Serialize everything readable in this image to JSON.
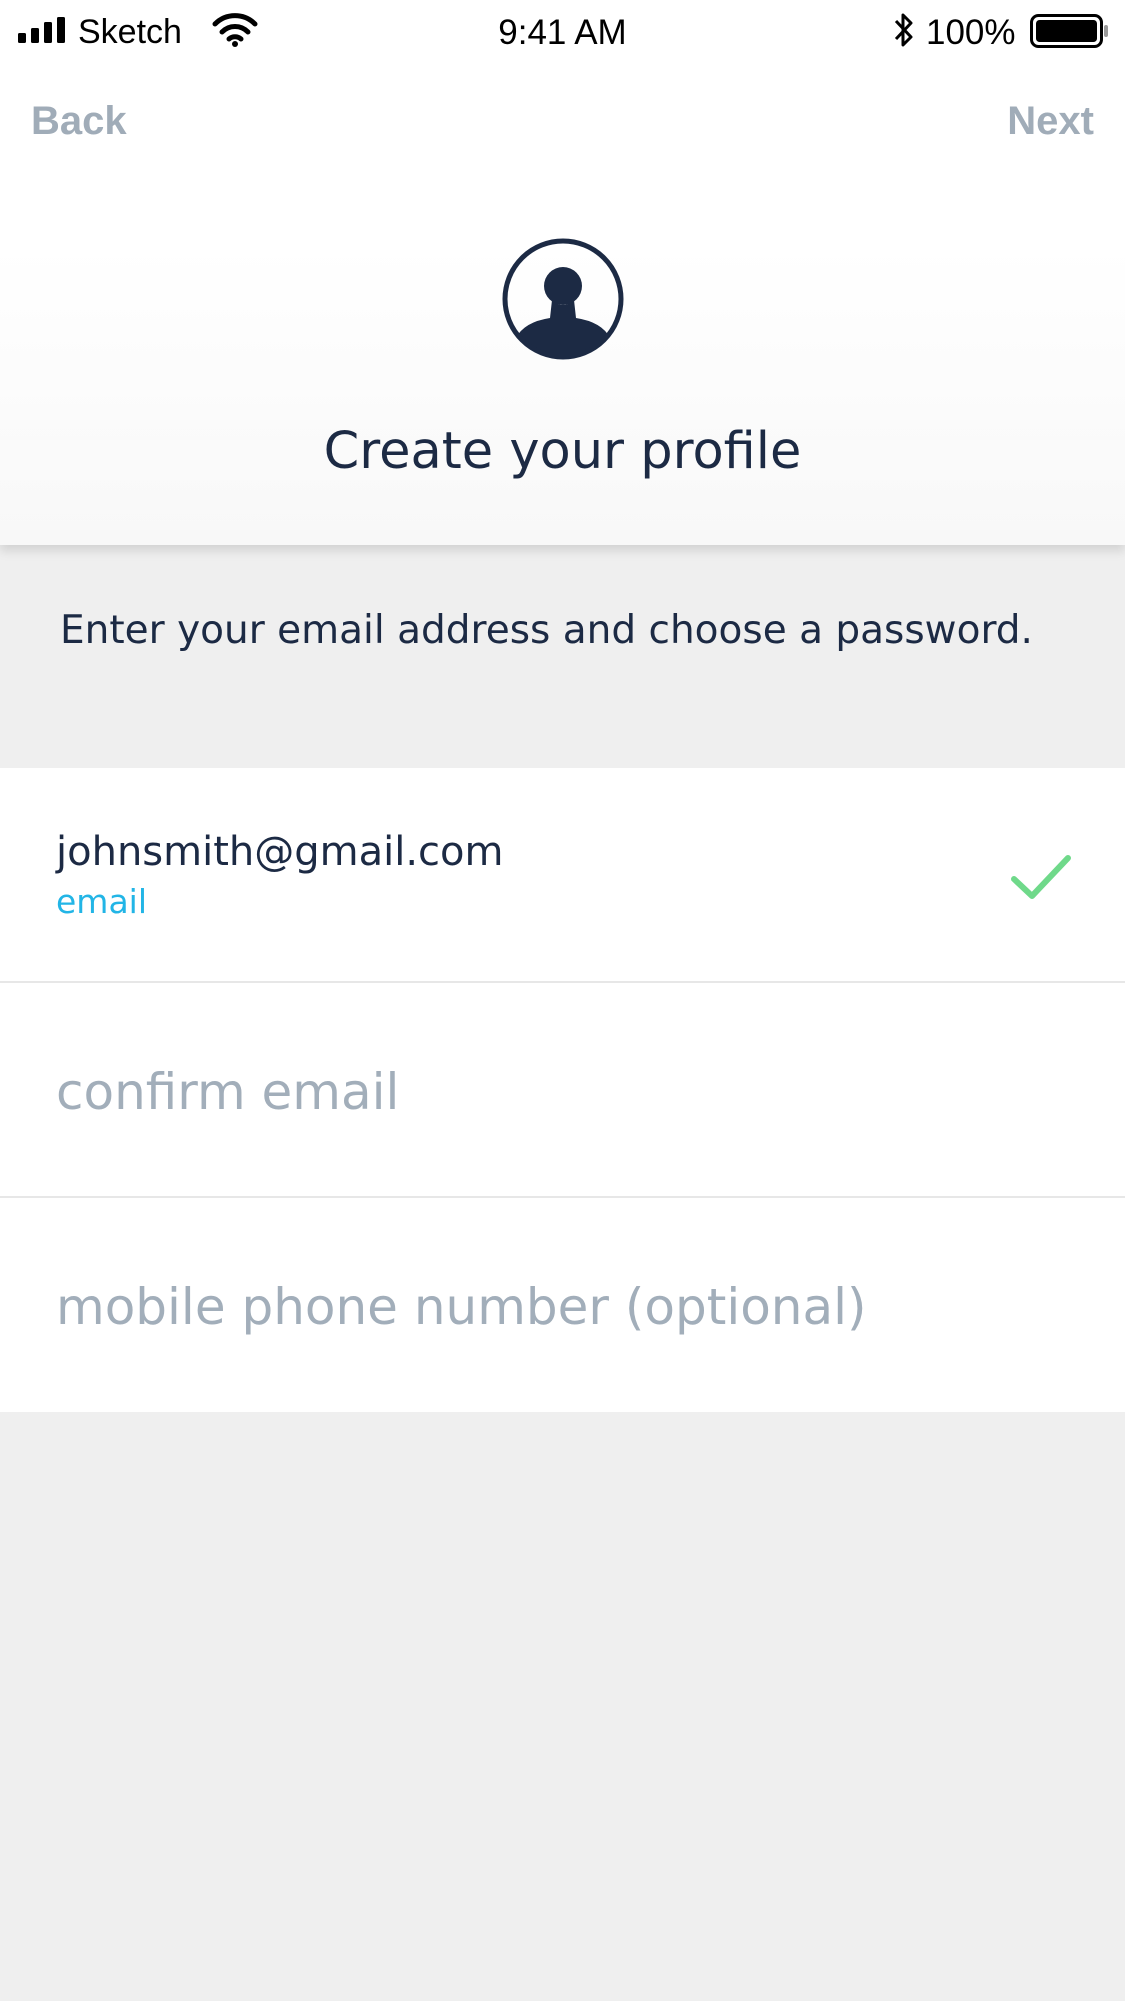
{
  "status_bar": {
    "carrier": "Sketch",
    "time": "9:41 AM",
    "battery_percent": "100%",
    "icons": [
      "signal-icon",
      "wifi-icon",
      "bluetooth-icon",
      "battery-icon"
    ]
  },
  "nav": {
    "back_label": "Back",
    "next_label": "Next"
  },
  "header": {
    "avatar_icon": "profile-avatar-icon",
    "title": "Create your profile"
  },
  "instructions": "Enter your email address and choose a password.",
  "form": {
    "email": {
      "value": "johnsmith@gmail.com",
      "label": "email",
      "valid_icon": "checkmark-icon"
    },
    "confirm_email": {
      "value": "",
      "placeholder": "confirm email"
    },
    "phone": {
      "value": "",
      "placeholder": "mobile phone number (optional)"
    }
  },
  "colors": {
    "text_dark": "#1c2a44",
    "nav_gray": "#a0acb8",
    "label_blue": "#22b5e6",
    "check_green": "#6fd98a",
    "background": "#efefef"
  }
}
